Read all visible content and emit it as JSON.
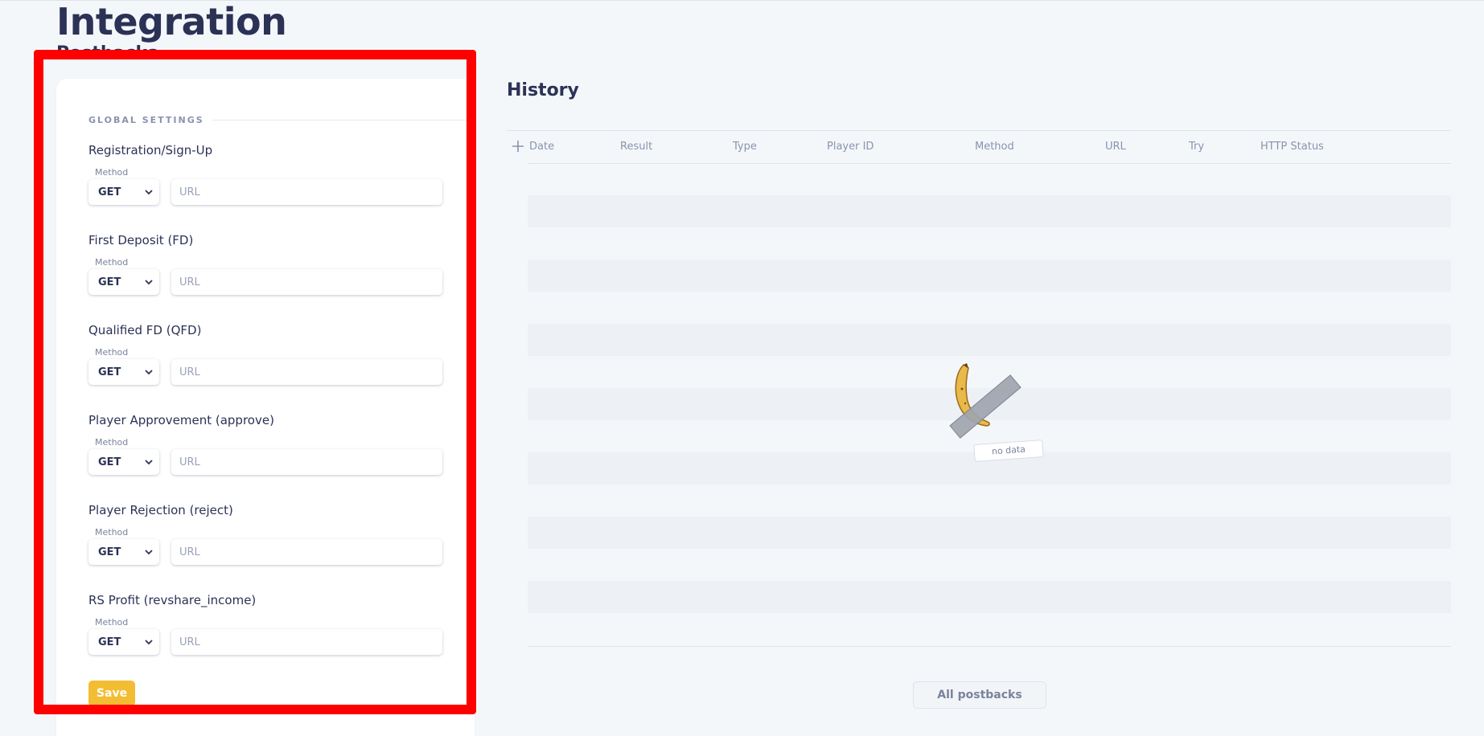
{
  "page": {
    "title": "Integration"
  },
  "postbacks": {
    "section_title": "Postbacks",
    "group_title": "GLOBAL SETTINGS",
    "method_label": "Method",
    "url_placeholder": "URL",
    "fields": [
      {
        "label": "Registration/Sign-Up",
        "method": "GET"
      },
      {
        "label": "First Deposit (FD)",
        "method": "GET"
      },
      {
        "label": "Qualified FD (QFD)",
        "method": "GET"
      },
      {
        "label": "Player Approvement (approve)",
        "method": "GET"
      },
      {
        "label": "Player Rejection (reject)",
        "method": "GET"
      },
      {
        "label": "RS Profit (revshare_income)",
        "method": "GET"
      }
    ],
    "save_label": "Save"
  },
  "history": {
    "title": "History",
    "columns": [
      "Date",
      "Result",
      "Type",
      "Player ID",
      "Method",
      "URL",
      "Try",
      "HTTP Status"
    ],
    "empty_text": "no data",
    "all_button": "All postbacks"
  },
  "colors": {
    "accent": "#f3bd33",
    "highlight": "#ff0000",
    "text": "#2b3256",
    "background": "#f4f7fa"
  },
  "icons": {
    "expand": "plus-icon",
    "select_arrow": "chevron-down-icon",
    "empty_illustration": "taped-banana-icon"
  }
}
